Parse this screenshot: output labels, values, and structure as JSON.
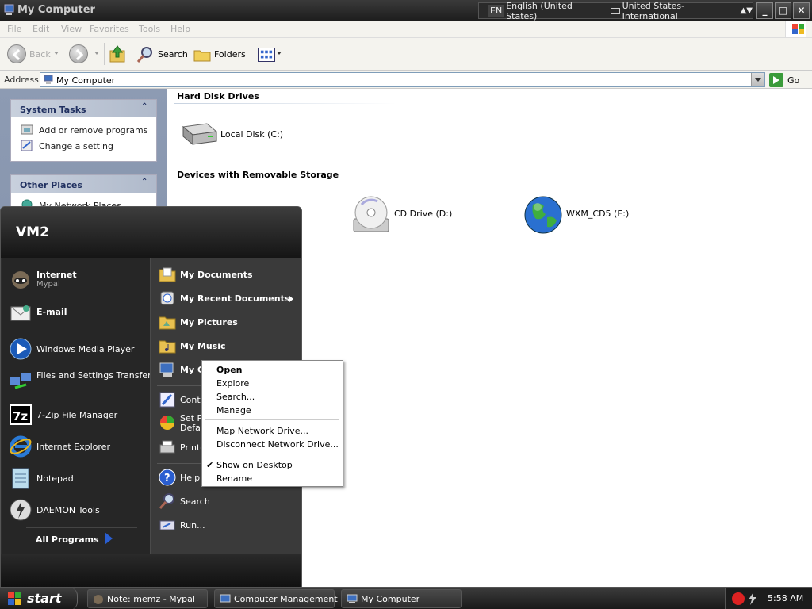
{
  "window": {
    "title": "My Computer",
    "language_bar": {
      "lang_code": "EN",
      "language": "English (United States)",
      "keyboard": "United States-International"
    },
    "buttons": {
      "minimize": "_",
      "maximize": "□",
      "close": "✕"
    }
  },
  "menubar": [
    "File",
    "Edit",
    "View",
    "Favorites",
    "Tools",
    "Help"
  ],
  "toolbar": {
    "back": "Back",
    "search": "Search",
    "folders": "Folders"
  },
  "address": {
    "label": "Address",
    "value": "My Computer",
    "go": "Go"
  },
  "tasks": {
    "system": {
      "title": "System Tasks",
      "items": [
        "Add or remove programs",
        "Change a setting"
      ]
    },
    "other": {
      "title": "Other Places",
      "items": [
        "My Network Places"
      ]
    }
  },
  "content": {
    "groups": [
      {
        "title": "Hard Disk Drives",
        "drives": [
          "Local Disk (C:)"
        ]
      },
      {
        "title": "Devices with Removable Storage",
        "drives": [
          "CD Drive (D:)",
          "WXM_CD5 (E:)"
        ]
      }
    ]
  },
  "start_menu": {
    "user": "VM2",
    "pinned": [
      {
        "name": "Internet",
        "sub": "Mypal"
      },
      {
        "name": "E-mail",
        "sub": ""
      }
    ],
    "recent": [
      "Windows Media Player",
      "Files and Settings Transfer Wizard",
      "7-Zip File Manager",
      "Internet Explorer",
      "Notepad",
      "DAEMON Tools"
    ],
    "all_programs": "All Programs",
    "right": [
      "My Documents",
      "My Recent Documents",
      "My Pictures",
      "My Music",
      "My Co",
      "Contro",
      "Set Pr",
      "Defau",
      "Printe",
      "Help a",
      "Search",
      "Run..."
    ]
  },
  "context_menu": {
    "items": [
      {
        "label": "Open",
        "bold": true
      },
      {
        "label": "Explore"
      },
      {
        "label": "Search..."
      },
      {
        "label": "Manage"
      },
      {
        "label": "Map Network Drive..."
      },
      {
        "label": "Disconnect Network Drive..."
      },
      {
        "label": "Show on Desktop",
        "checked": true
      },
      {
        "label": "Rename"
      }
    ]
  },
  "taskbar": {
    "start": "start",
    "tasks": [
      "Note: memz - Mypal",
      "Computer Management",
      "My Computer"
    ],
    "clock": "5:58 AM"
  }
}
